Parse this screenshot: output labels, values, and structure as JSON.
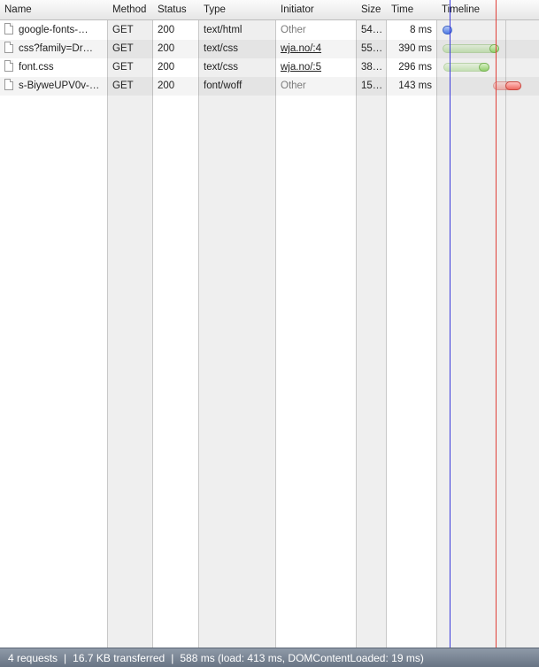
{
  "columns": {
    "name": "Name",
    "method": "Method",
    "status": "Status",
    "type": "Type",
    "initiator": "Initiator",
    "size": "Size",
    "time": "Time",
    "timeline": "Timeline"
  },
  "rows": [
    {
      "name": "google-fonts-…",
      "method": "GET",
      "status": "200",
      "type": "text/html",
      "initiator": "Other",
      "size": "54…",
      "time": "8 ms"
    },
    {
      "name": "css?family=Dr…",
      "method": "GET",
      "status": "200",
      "type": "text/css",
      "initiator": "wja.no/:4",
      "size": "55…",
      "time": "390 ms"
    },
    {
      "name": "font.css",
      "method": "GET",
      "status": "200",
      "type": "text/css",
      "initiator": "wja.no/:5",
      "size": "38…",
      "time": "296 ms"
    },
    {
      "name": "s-BiyweUPV0v-…",
      "method": "GET",
      "status": "200",
      "type": "font/woff",
      "initiator": "Other",
      "size": "15…",
      "time": "143 ms"
    }
  ],
  "status": {
    "requests": "4 requests",
    "transferred": "16.7 KB transferred",
    "timing": "588 ms (load: 413 ms, DOMContentLoaded: 19 ms)"
  },
  "colors": {
    "dom_content_loaded_line": "#3b3bdc",
    "load_line": "#e0403a"
  }
}
